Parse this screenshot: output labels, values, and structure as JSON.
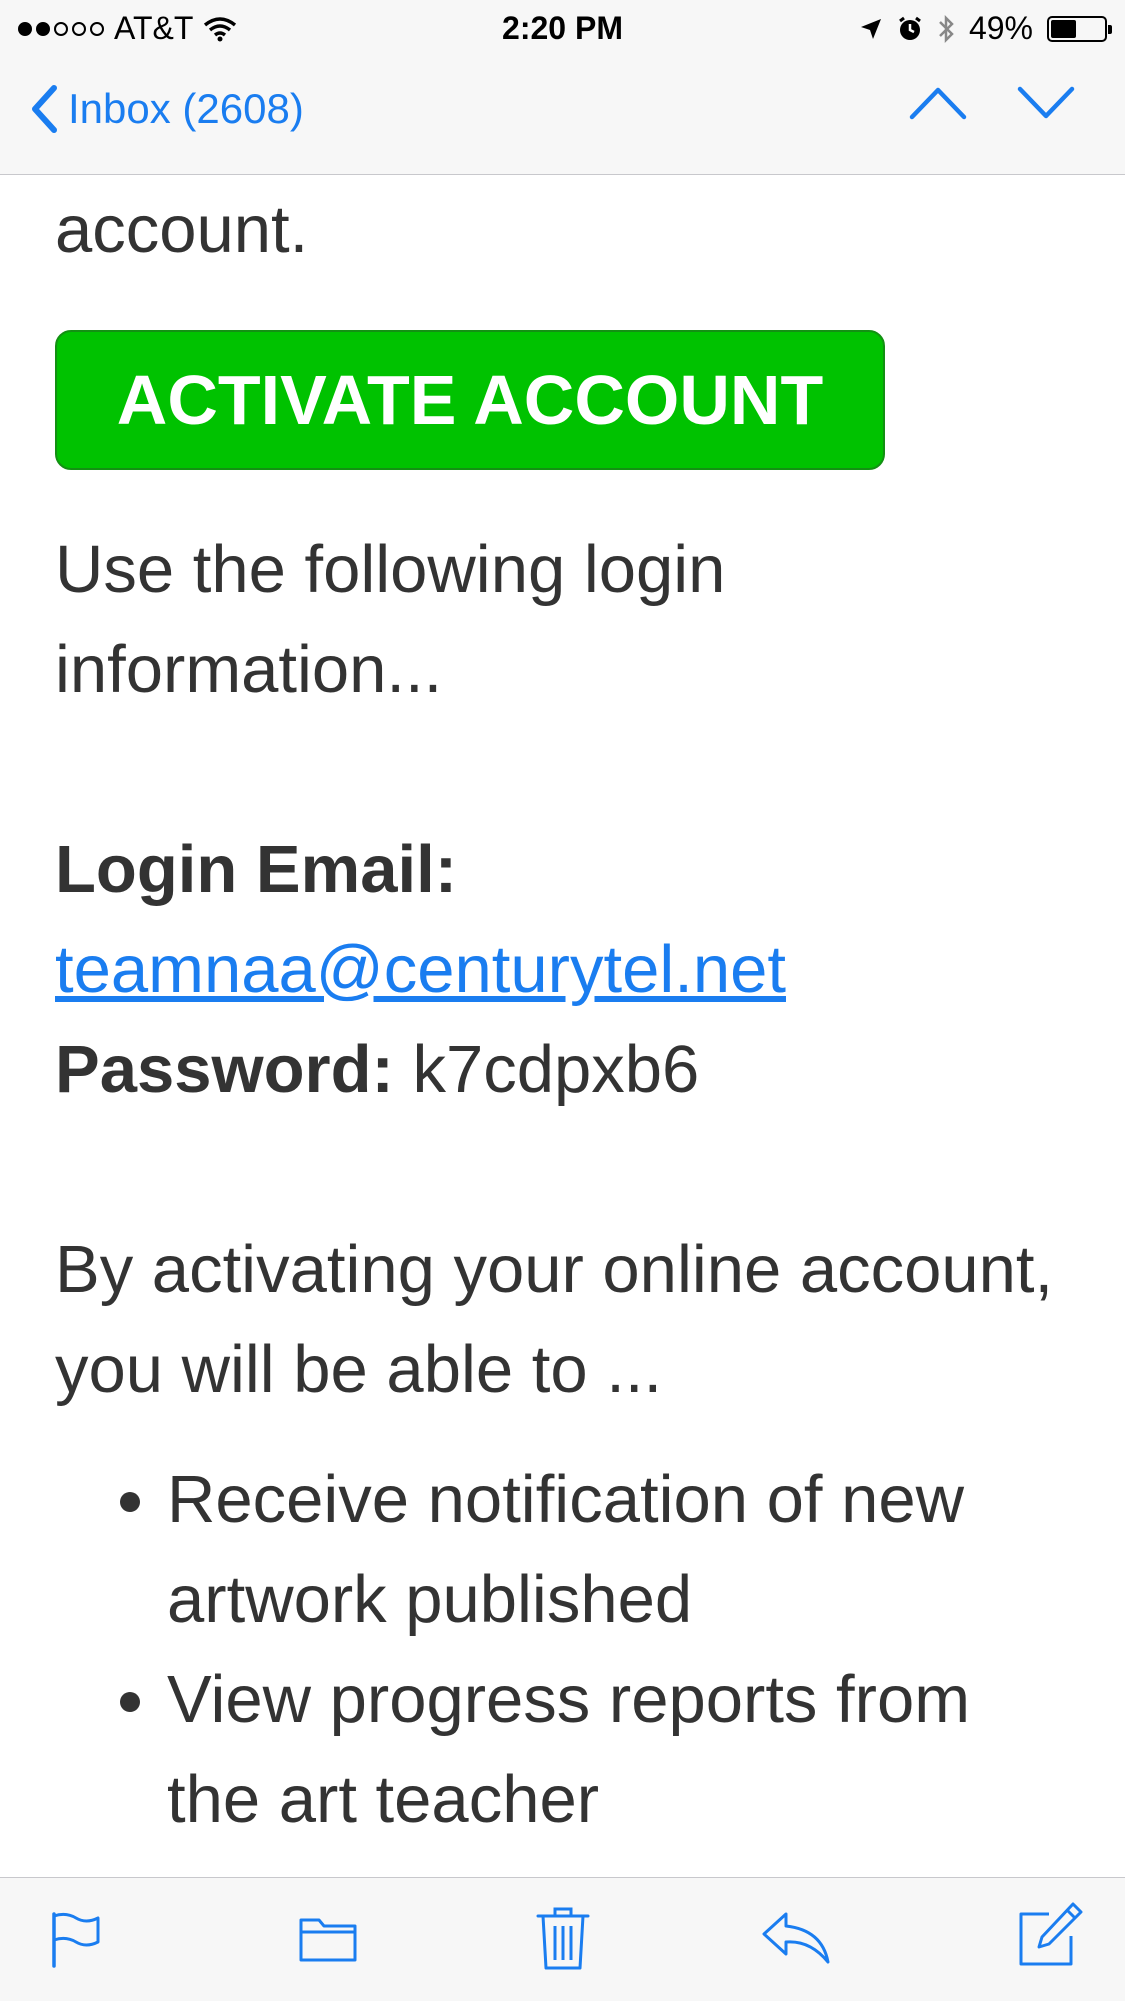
{
  "status_bar": {
    "carrier": "AT&T",
    "time": "2:20 PM",
    "battery": "49%",
    "battery_level": 0.49
  },
  "nav": {
    "back_label": "Inbox (2608)"
  },
  "email": {
    "intro_tail": "account.",
    "activate_button": "ACTIVATE ACCOUNT",
    "login_intro": "Use the following login information...",
    "login_email_label": "Login Email:",
    "login_email_value": "teamnaa@centurytel.net",
    "password_label": "Password:",
    "password_value": "k7cdpxb6",
    "activating_text": "By activating your online account, you will be able to ...",
    "benefits": [
      "Receive notification of new artwork published",
      "View progress reports from the art teacher"
    ]
  },
  "colors": {
    "accent": "#1a7df0",
    "button_green": "#00c200"
  },
  "icons": {
    "toolbar": [
      "flag-icon",
      "folder-icon",
      "trash-icon",
      "reply-icon",
      "compose-icon"
    ]
  }
}
